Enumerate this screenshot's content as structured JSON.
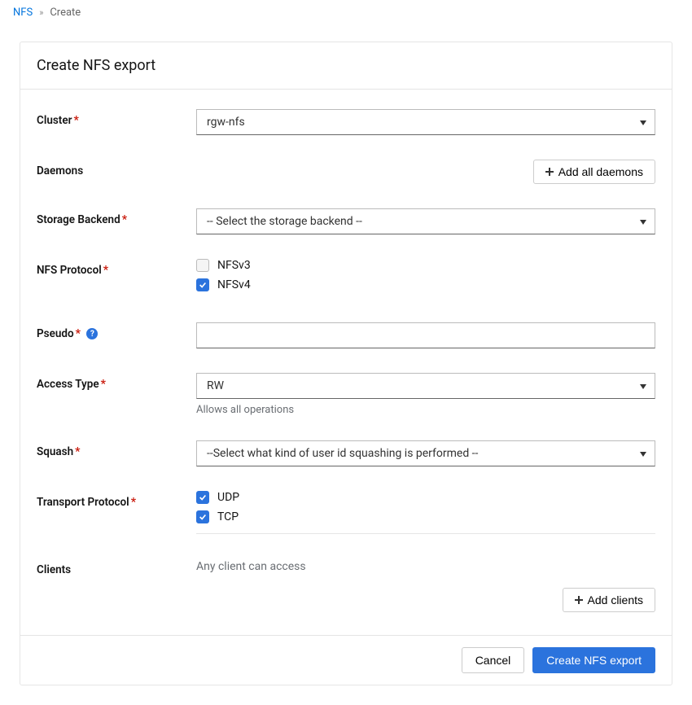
{
  "breadcrumb": {
    "root": "NFS",
    "current": "Create"
  },
  "panel": {
    "title": "Create NFS export"
  },
  "labels": {
    "cluster": "Cluster",
    "daemons": "Daemons",
    "storage_backend": "Storage Backend",
    "nfs_protocol": "NFS Protocol",
    "pseudo": "Pseudo",
    "access_type": "Access Type",
    "squash": "Squash",
    "transport_protocol": "Transport Protocol",
    "clients": "Clients"
  },
  "values": {
    "cluster": "rgw-nfs",
    "storage_backend_placeholder": "-- Select the storage backend --",
    "pseudo": "",
    "access_type": "RW",
    "access_type_help": "Allows all operations",
    "squash_placeholder": "--Select what kind of user id squashing is performed --",
    "clients_help": "Any client can access"
  },
  "protocols": {
    "nfsv3": {
      "label": "NFSv3",
      "checked": false
    },
    "nfsv4": {
      "label": "NFSv4",
      "checked": true
    }
  },
  "transport": {
    "udp": {
      "label": "UDP",
      "checked": true
    },
    "tcp": {
      "label": "TCP",
      "checked": true
    }
  },
  "buttons": {
    "add_daemons": "Add all daemons",
    "add_clients": "Add clients",
    "cancel": "Cancel",
    "submit": "Create NFS export"
  }
}
